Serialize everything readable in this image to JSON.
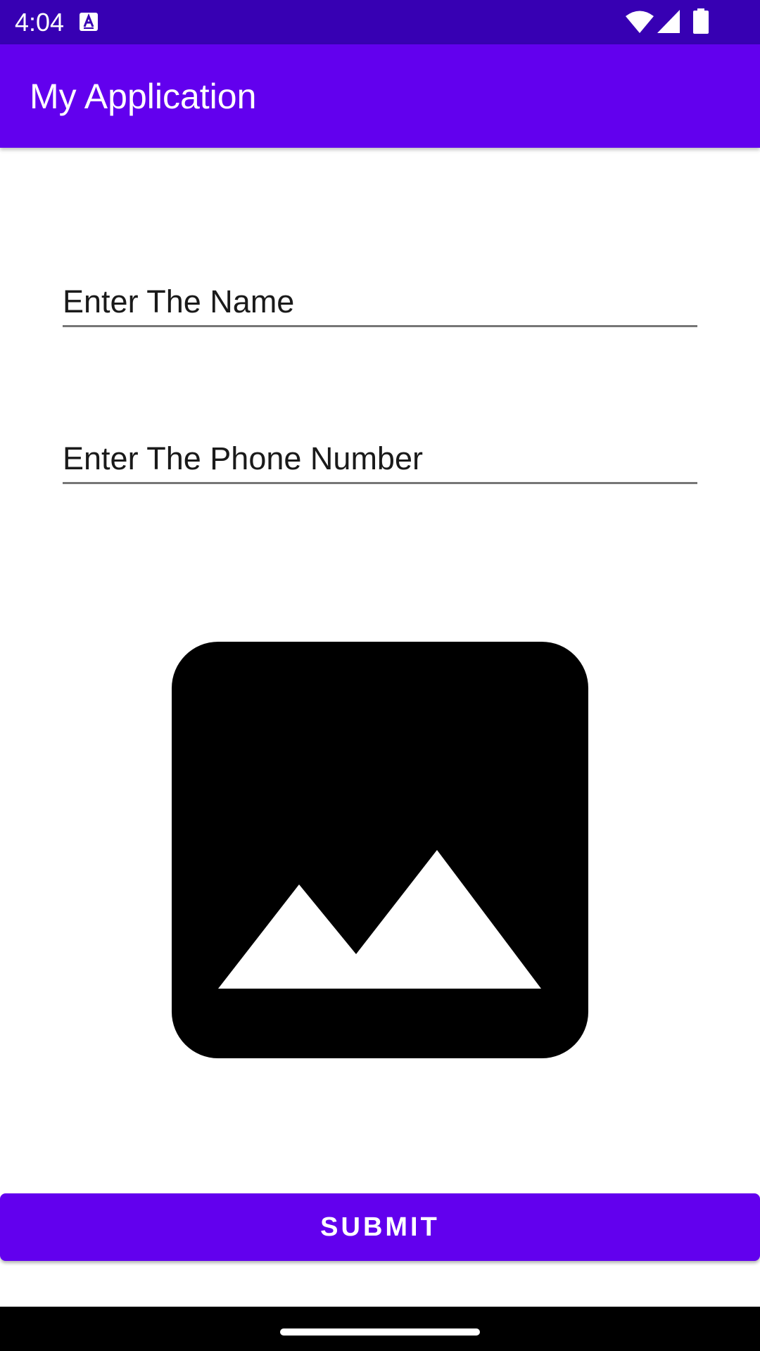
{
  "status_bar": {
    "time": "4:04",
    "notification_icon": "text-format-icon",
    "icons": [
      "wifi-icon",
      "signal-icon",
      "battery-icon"
    ]
  },
  "app_bar": {
    "title": "My Application",
    "color": "#6200ee"
  },
  "form": {
    "name_field": {
      "placeholder": "Enter The Name",
      "value": ""
    },
    "phone_field": {
      "placeholder": "Enter The Phone Number",
      "value": ""
    },
    "image": {
      "icon": "image-placeholder-icon"
    },
    "submit_label": "SUBMIT"
  },
  "colors": {
    "status_bar": "#3700b3",
    "primary": "#6200ee",
    "nav_bar": "#000000"
  }
}
